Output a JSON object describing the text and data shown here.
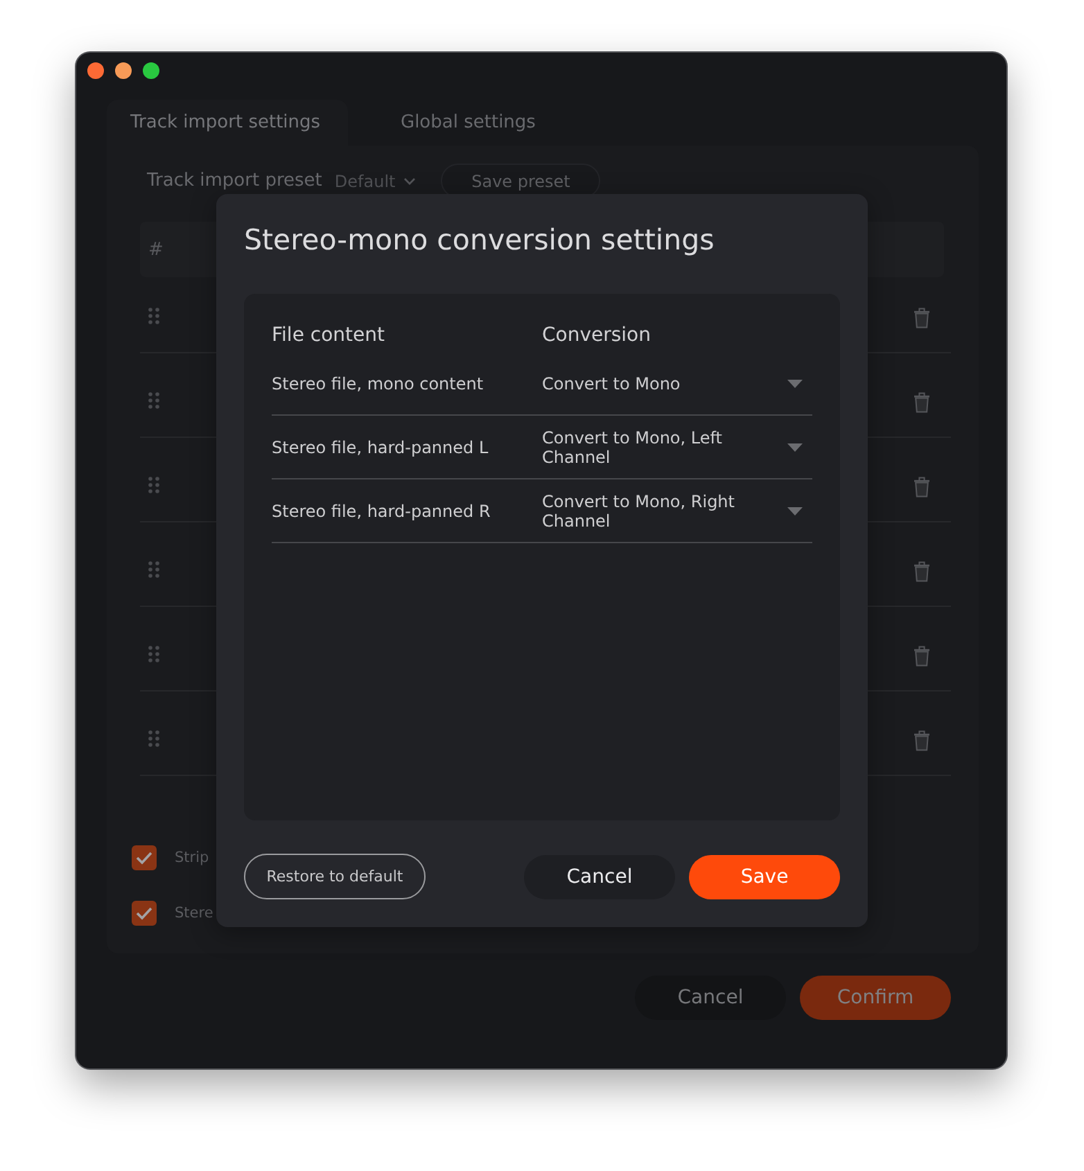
{
  "window": {
    "controls": [
      {
        "kind": "close"
      },
      {
        "kind": "minimize"
      },
      {
        "kind": "zoom"
      }
    ]
  },
  "tabs": [
    {
      "label": "Track import settings",
      "selected": true
    },
    {
      "label": "Global settings",
      "selected": false
    }
  ],
  "preset": {
    "label": "Track import preset",
    "value": "Default",
    "save_button": "Save preset"
  },
  "track_table": {
    "columns": [
      "#"
    ],
    "rows": [
      {
        "kind": "track"
      },
      {
        "kind": "track"
      },
      {
        "kind": "track"
      },
      {
        "kind": "track"
      },
      {
        "kind": "track"
      },
      {
        "kind": "track"
      }
    ]
  },
  "options": [
    {
      "label": "Strip",
      "checked": true
    },
    {
      "label": "Stere",
      "checked": true
    }
  ],
  "buttons": [
    {
      "label": "Cancel",
      "kind": "secondary"
    },
    {
      "label": "Confirm",
      "kind": "primary"
    }
  ],
  "dialog": {
    "title": "Stereo-mono conversion settings",
    "columns": [
      "File content",
      "Conversion"
    ],
    "rows": [
      {
        "file_content": "Stereo file, mono content",
        "conversion": "Convert to Mono"
      },
      {
        "file_content": "Stereo file, hard-panned L",
        "conversion": "Convert to Mono, Left Channel"
      },
      {
        "file_content": "Stereo file, hard-panned R",
        "conversion": "Convert to Mono, Right Channel"
      }
    ],
    "buttons": [
      {
        "label": "Restore to default",
        "kind": "outline"
      },
      {
        "label": "Cancel",
        "kind": "secondary"
      },
      {
        "label": "Save",
        "kind": "primary"
      }
    ]
  }
}
